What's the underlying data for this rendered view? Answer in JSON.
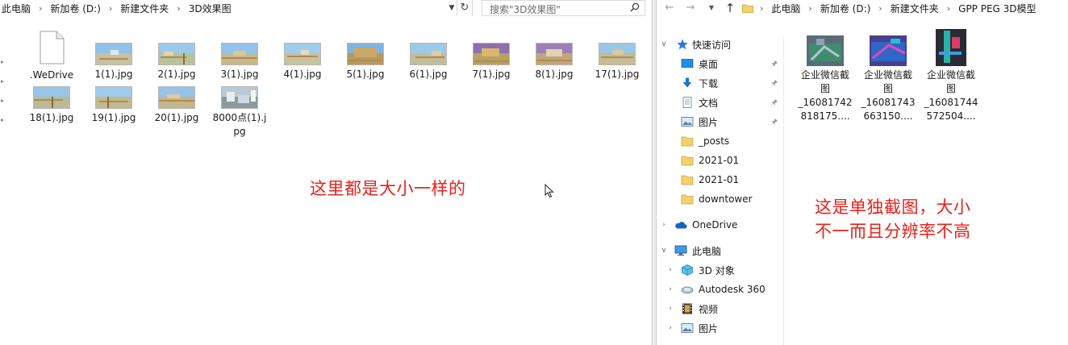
{
  "left": {
    "breadcrumb": [
      "此电脑",
      "新加卷 (D:)",
      "新建文件夹",
      "3D效果图"
    ],
    "search_placeholder": "搜索\"3D效果图\"",
    "files": [
      {
        "name": ".WeDrive",
        "kind": "document"
      },
      {
        "name": "1(1).jpg",
        "kind": "image"
      },
      {
        "name": "2(1).jpg",
        "kind": "image"
      },
      {
        "name": "3(1).jpg",
        "kind": "image"
      },
      {
        "name": "4(1).jpg",
        "kind": "image"
      },
      {
        "name": "5(1).jpg",
        "kind": "image"
      },
      {
        "name": "6(1).jpg",
        "kind": "image"
      },
      {
        "name": "7(1).jpg",
        "kind": "image"
      },
      {
        "name": "8(1).jpg",
        "kind": "image"
      },
      {
        "name": "17(1).jpg",
        "kind": "image"
      },
      {
        "name": "18(1).jpg",
        "kind": "image"
      },
      {
        "name": "19(1).jpg",
        "kind": "image"
      },
      {
        "name": "20(1).jpg",
        "kind": "image"
      },
      {
        "name": "8000点(1).jpg",
        "kind": "image"
      }
    ],
    "annotation": "这里都是大小一样的"
  },
  "right": {
    "breadcrumb": [
      "此电脑",
      "新加卷 (D:)",
      "新建文件夹",
      "GPP PEG 3D模型"
    ],
    "nav": {
      "quick_access": "快速访问",
      "pinned": [
        "桌面",
        "下载",
        "文档",
        "图片"
      ],
      "folders": [
        "_posts",
        "2021-01",
        "2021-01",
        "downtower"
      ],
      "onedrive": "OneDrive",
      "this_pc": "此电脑",
      "pc_items": [
        "3D 对象",
        "Autodesk 360",
        "视频",
        "图片"
      ]
    },
    "files": [
      {
        "line1": "企业微信截",
        "line2": "图",
        "line3": "_16081742",
        "line4": "818175...."
      },
      {
        "line1": "企业微信截",
        "line2": "图",
        "line3": "_16081743",
        "line4": "663150...."
      },
      {
        "line1": "企业微信截",
        "line2": "图",
        "line3": "_16081744",
        "line4": "572504...."
      }
    ],
    "annotation_line1": "这是单独截图，大小",
    "annotation_line2": "不一而且分辨率不高"
  },
  "colors": {
    "annotation": "#e8221c",
    "folder": "#f4d06f",
    "accent_blue": "#1e73d6"
  }
}
